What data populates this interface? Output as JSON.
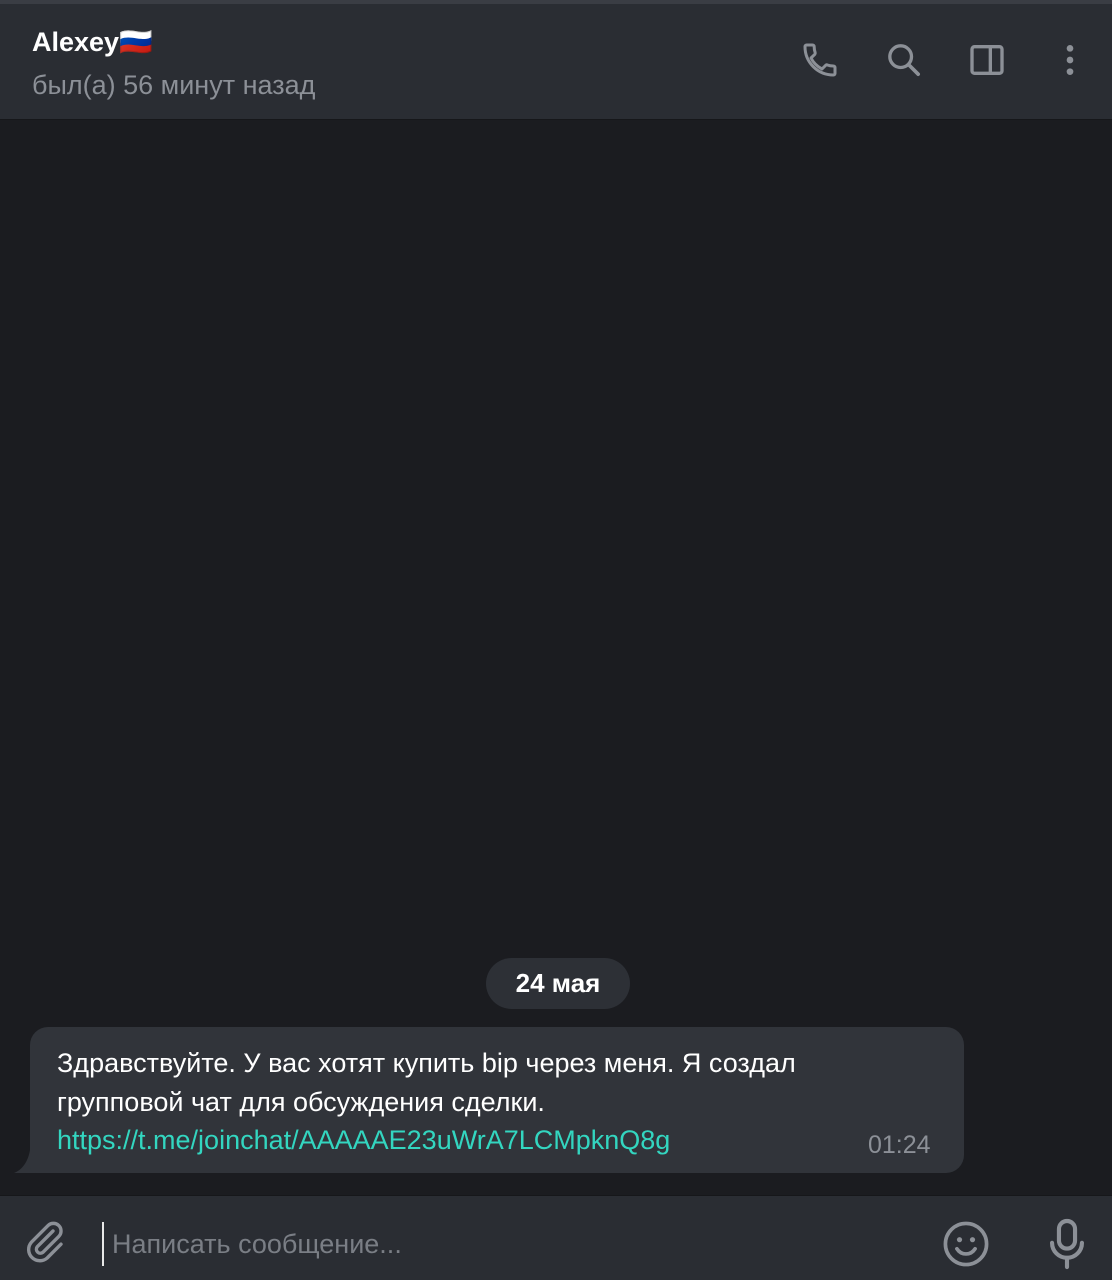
{
  "header": {
    "title": "Alexey🇷🇺",
    "status": "был(а) 56 минут назад",
    "icons": [
      "phone-icon",
      "search-icon",
      "sidebar-toggle-icon",
      "more-vertical-icon"
    ]
  },
  "chat": {
    "date_label": "24 мая",
    "message": {
      "text": "Здравствуйте. У вас хотят купить bip через меня. Я создал групповой чат для обсуждения сделки.",
      "link": "https://t.me/joinchat/AAAAAE23uWrA7LCMpknQ8g",
      "time": "01:24"
    }
  },
  "composer": {
    "placeholder": "Написать сообщение...",
    "value": "",
    "icons": [
      "paperclip-icon",
      "emoji-icon",
      "microphone-icon"
    ]
  },
  "colors": {
    "background": "#1b1c20",
    "header": "#2a2d33",
    "bubble": "#31343a",
    "link": "#33d6c0",
    "muted": "#8c9097"
  }
}
